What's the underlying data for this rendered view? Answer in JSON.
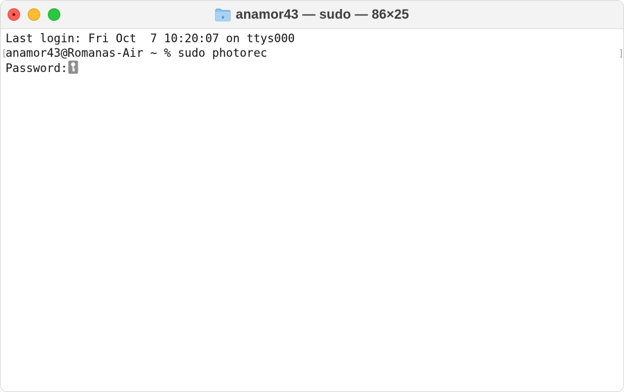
{
  "window": {
    "title": "anamor43 — sudo — 86×25"
  },
  "icons": {
    "title_icon": "folder-icon",
    "cursor_icon": "key-icon"
  },
  "terminal": {
    "lines": [
      "Last login: Fri Oct  7 10:20:07 on ttys000",
      "anamor43@Romanas-Air ~ % sudo photorec",
      "Password:"
    ]
  },
  "colors": {
    "close": "#ff5f57",
    "minimize": "#febc2e",
    "maximize": "#28c840",
    "titlebar": "#f3f3f3",
    "folder": "#7fb6e3",
    "cursor": "#8e8e8e"
  }
}
